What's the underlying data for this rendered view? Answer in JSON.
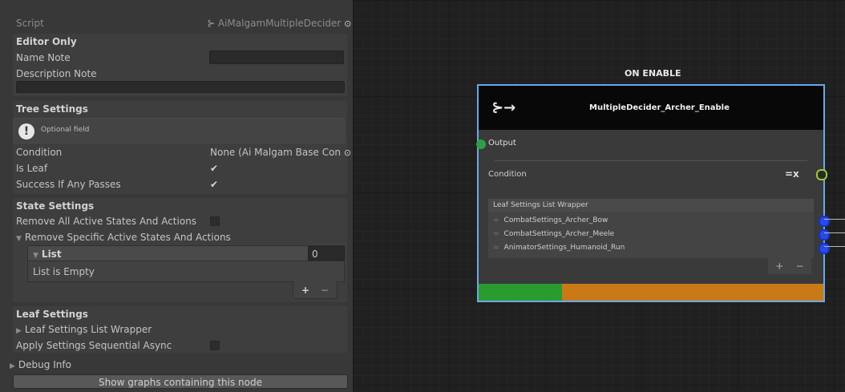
{
  "inspector": {
    "script": {
      "label": "Script",
      "value": "AiMalgamMultipleDecider"
    },
    "editor_only": {
      "header": "Editor Only",
      "name_note": "Name Note",
      "description_note": "Description Note"
    },
    "tree_settings": {
      "header": "Tree Settings",
      "info_text": "Optional field",
      "condition_label": "Condition",
      "condition_value": "None (Ai Malgam Base Con",
      "is_leaf_label": "Is Leaf",
      "is_leaf_check": "✔",
      "success_label": "Success If Any Passes",
      "success_check": "✔"
    },
    "state_settings": {
      "header": "State Settings",
      "remove_all_label": "Remove All Active States And Actions",
      "remove_specific_label": "Remove Specific Active States And Actions",
      "list_label": "List",
      "list_count": "0",
      "list_empty": "List is Empty",
      "add_label": "+",
      "remove_label": "−"
    },
    "leaf_settings": {
      "header": "Leaf Settings",
      "wrapper_label": "Leaf Settings List Wrapper",
      "apply_async_label": "Apply Settings Sequential Async"
    },
    "debug_info": "Debug Info",
    "show_graphs_button": "Show graphs containing this node"
  },
  "graph": {
    "group_title": "ON ENABLE",
    "node": {
      "icon": "split-arrow-icon",
      "title": "MultipleDecider_Archer_Enable",
      "output_label": "Output",
      "condition_label": "Condition",
      "wrapper_header": "Leaf Settings List Wrapper",
      "items": [
        "CombatSettings_Archer_Bow",
        "CombatSettings_Archer_Meele",
        "AnimatorSettings_Humanoid_Run"
      ],
      "add_label": "+",
      "remove_label": "−"
    },
    "colors": {
      "selection": "#6aa8e8",
      "success_bar": "#2a9b2e",
      "running_bar": "#c97a17",
      "output_port": "#2ea043",
      "item_port": "#2a4ae8"
    }
  }
}
